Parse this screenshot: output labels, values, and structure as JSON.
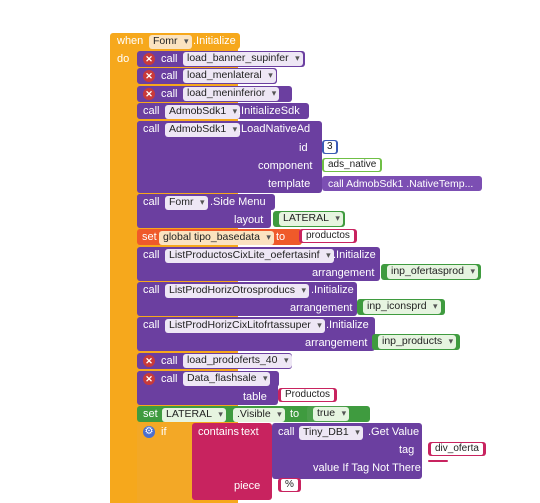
{
  "event": {
    "when": "when",
    "component": "Fomr",
    "event_name": ".Initialize",
    "do": "do"
  },
  "rows": {
    "r1": {
      "call": "call",
      "proc": "load_banner_supinfer"
    },
    "r2": {
      "call": "call",
      "proc": "load_menlateral"
    },
    "r3": {
      "call": "call",
      "proc": "load_meninferior"
    },
    "r4": {
      "call": "call",
      "comp": "AdmobSdk1",
      "method": ".InitializeSdk"
    },
    "r5": {
      "call": "call",
      "comp": "AdmobSdk1",
      "method": ".LoadNativeAd",
      "id_label": "id",
      "id_value": "3",
      "component_label": "component",
      "component_value": "ads_native",
      "template_label": "template",
      "template_value": "call  AdmobSdk1 .NativeTemp..."
    },
    "r6": {
      "call": "call",
      "comp": "Fomr",
      "method": ".Side Menu",
      "layout_label": "layout",
      "layout_value": "LATERAL"
    },
    "r7": {
      "set": "set",
      "var": "global tipo_basedata",
      "to": "to",
      "value": "productos"
    },
    "r8": {
      "call": "call",
      "comp": "ListProductosCixLite_oefertasinf",
      "method": ".Initialize",
      "arg_label": "arrangement",
      "arg_value": "inp_ofertasprod"
    },
    "r9": {
      "call": "call",
      "comp": "ListProdHorizOtrosproducs",
      "method": ".Initialize",
      "arg_label": "arrangement",
      "arg_value": "inp_iconsprd"
    },
    "r10": {
      "call": "call",
      "comp": "ListProdHorizCixLitofrtassuper",
      "method": ".Initialize",
      "arg_label": "arrangement",
      "arg_value": "inp_products"
    },
    "r11": {
      "call": "call",
      "proc": "load_prodoferts_40"
    },
    "r12": {
      "call": "call",
      "proc": "Data_flashsale",
      "table_label": "table",
      "table_value": "Productos"
    },
    "r13": {
      "set": "set",
      "comp": "LATERAL",
      "prop": ".Visible",
      "to": "to",
      "value": "true"
    },
    "r14": {
      "if": "if",
      "contains": "contains",
      "text_label": "text",
      "call": "call",
      "comp": "Tiny_DB1",
      "method": ".Get Value",
      "tag_label": "tag",
      "tag_value": "div_oferta",
      "default_label": "value If Tag Not There",
      "default_value": "",
      "piece_label": "piece",
      "piece_value": "%"
    }
  },
  "colors": {
    "event": "#f6a81c",
    "procedure": "#6b3fa0",
    "variable": "#ef5a2a",
    "component_green": "#3f9b3f",
    "text": "#c8235f",
    "control": "#f3a826"
  }
}
